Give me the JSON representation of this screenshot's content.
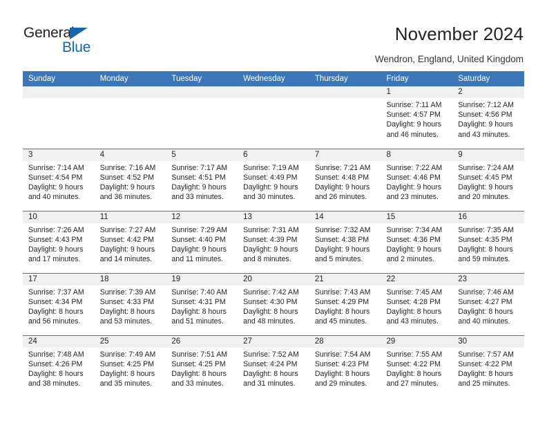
{
  "brand": {
    "name_top": "General",
    "name_bottom": "Blue",
    "color_dark": "#231f20",
    "color_blue": "#1565b0"
  },
  "header": {
    "title": "November 2024",
    "subtitle": "Wendron, England, United Kingdom"
  },
  "theme": {
    "header_blue": "#3a76b8",
    "daynum_band": "#f0f0f0",
    "text": "#222222"
  },
  "weekday_headers": [
    "Sunday",
    "Monday",
    "Tuesday",
    "Wednesday",
    "Thursday",
    "Friday",
    "Saturday"
  ],
  "labels": {
    "sunrise": "Sunrise:",
    "sunset": "Sunset:",
    "daylight": "Daylight:"
  },
  "weeks": [
    [
      {
        "day": ""
      },
      {
        "day": ""
      },
      {
        "day": ""
      },
      {
        "day": ""
      },
      {
        "day": ""
      },
      {
        "day": "1",
        "sunrise": "Sunrise: 7:11 AM",
        "sunset": "Sunset: 4:57 PM",
        "daylight_1": "Daylight: 9 hours",
        "daylight_2": "and 46 minutes."
      },
      {
        "day": "2",
        "sunrise": "Sunrise: 7:12 AM",
        "sunset": "Sunset: 4:56 PM",
        "daylight_1": "Daylight: 9 hours",
        "daylight_2": "and 43 minutes."
      }
    ],
    [
      {
        "day": "3",
        "sunrise": "Sunrise: 7:14 AM",
        "sunset": "Sunset: 4:54 PM",
        "daylight_1": "Daylight: 9 hours",
        "daylight_2": "and 40 minutes."
      },
      {
        "day": "4",
        "sunrise": "Sunrise: 7:16 AM",
        "sunset": "Sunset: 4:52 PM",
        "daylight_1": "Daylight: 9 hours",
        "daylight_2": "and 36 minutes."
      },
      {
        "day": "5",
        "sunrise": "Sunrise: 7:17 AM",
        "sunset": "Sunset: 4:51 PM",
        "daylight_1": "Daylight: 9 hours",
        "daylight_2": "and 33 minutes."
      },
      {
        "day": "6",
        "sunrise": "Sunrise: 7:19 AM",
        "sunset": "Sunset: 4:49 PM",
        "daylight_1": "Daylight: 9 hours",
        "daylight_2": "and 30 minutes."
      },
      {
        "day": "7",
        "sunrise": "Sunrise: 7:21 AM",
        "sunset": "Sunset: 4:48 PM",
        "daylight_1": "Daylight: 9 hours",
        "daylight_2": "and 26 minutes."
      },
      {
        "day": "8",
        "sunrise": "Sunrise: 7:22 AM",
        "sunset": "Sunset: 4:46 PM",
        "daylight_1": "Daylight: 9 hours",
        "daylight_2": "and 23 minutes."
      },
      {
        "day": "9",
        "sunrise": "Sunrise: 7:24 AM",
        "sunset": "Sunset: 4:45 PM",
        "daylight_1": "Daylight: 9 hours",
        "daylight_2": "and 20 minutes."
      }
    ],
    [
      {
        "day": "10",
        "sunrise": "Sunrise: 7:26 AM",
        "sunset": "Sunset: 4:43 PM",
        "daylight_1": "Daylight: 9 hours",
        "daylight_2": "and 17 minutes."
      },
      {
        "day": "11",
        "sunrise": "Sunrise: 7:27 AM",
        "sunset": "Sunset: 4:42 PM",
        "daylight_1": "Daylight: 9 hours",
        "daylight_2": "and 14 minutes."
      },
      {
        "day": "12",
        "sunrise": "Sunrise: 7:29 AM",
        "sunset": "Sunset: 4:40 PM",
        "daylight_1": "Daylight: 9 hours",
        "daylight_2": "and 11 minutes."
      },
      {
        "day": "13",
        "sunrise": "Sunrise: 7:31 AM",
        "sunset": "Sunset: 4:39 PM",
        "daylight_1": "Daylight: 9 hours",
        "daylight_2": "and 8 minutes."
      },
      {
        "day": "14",
        "sunrise": "Sunrise: 7:32 AM",
        "sunset": "Sunset: 4:38 PM",
        "daylight_1": "Daylight: 9 hours",
        "daylight_2": "and 5 minutes."
      },
      {
        "day": "15",
        "sunrise": "Sunrise: 7:34 AM",
        "sunset": "Sunset: 4:36 PM",
        "daylight_1": "Daylight: 9 hours",
        "daylight_2": "and 2 minutes."
      },
      {
        "day": "16",
        "sunrise": "Sunrise: 7:35 AM",
        "sunset": "Sunset: 4:35 PM",
        "daylight_1": "Daylight: 8 hours",
        "daylight_2": "and 59 minutes."
      }
    ],
    [
      {
        "day": "17",
        "sunrise": "Sunrise: 7:37 AM",
        "sunset": "Sunset: 4:34 PM",
        "daylight_1": "Daylight: 8 hours",
        "daylight_2": "and 56 minutes."
      },
      {
        "day": "18",
        "sunrise": "Sunrise: 7:39 AM",
        "sunset": "Sunset: 4:33 PM",
        "daylight_1": "Daylight: 8 hours",
        "daylight_2": "and 53 minutes."
      },
      {
        "day": "19",
        "sunrise": "Sunrise: 7:40 AM",
        "sunset": "Sunset: 4:31 PM",
        "daylight_1": "Daylight: 8 hours",
        "daylight_2": "and 51 minutes."
      },
      {
        "day": "20",
        "sunrise": "Sunrise: 7:42 AM",
        "sunset": "Sunset: 4:30 PM",
        "daylight_1": "Daylight: 8 hours",
        "daylight_2": "and 48 minutes."
      },
      {
        "day": "21",
        "sunrise": "Sunrise: 7:43 AM",
        "sunset": "Sunset: 4:29 PM",
        "daylight_1": "Daylight: 8 hours",
        "daylight_2": "and 45 minutes."
      },
      {
        "day": "22",
        "sunrise": "Sunrise: 7:45 AM",
        "sunset": "Sunset: 4:28 PM",
        "daylight_1": "Daylight: 8 hours",
        "daylight_2": "and 43 minutes."
      },
      {
        "day": "23",
        "sunrise": "Sunrise: 7:46 AM",
        "sunset": "Sunset: 4:27 PM",
        "daylight_1": "Daylight: 8 hours",
        "daylight_2": "and 40 minutes."
      }
    ],
    [
      {
        "day": "24",
        "sunrise": "Sunrise: 7:48 AM",
        "sunset": "Sunset: 4:26 PM",
        "daylight_1": "Daylight: 8 hours",
        "daylight_2": "and 38 minutes."
      },
      {
        "day": "25",
        "sunrise": "Sunrise: 7:49 AM",
        "sunset": "Sunset: 4:25 PM",
        "daylight_1": "Daylight: 8 hours",
        "daylight_2": "and 35 minutes."
      },
      {
        "day": "26",
        "sunrise": "Sunrise: 7:51 AM",
        "sunset": "Sunset: 4:25 PM",
        "daylight_1": "Daylight: 8 hours",
        "daylight_2": "and 33 minutes."
      },
      {
        "day": "27",
        "sunrise": "Sunrise: 7:52 AM",
        "sunset": "Sunset: 4:24 PM",
        "daylight_1": "Daylight: 8 hours",
        "daylight_2": "and 31 minutes."
      },
      {
        "day": "28",
        "sunrise": "Sunrise: 7:54 AM",
        "sunset": "Sunset: 4:23 PM",
        "daylight_1": "Daylight: 8 hours",
        "daylight_2": "and 29 minutes."
      },
      {
        "day": "29",
        "sunrise": "Sunrise: 7:55 AM",
        "sunset": "Sunset: 4:22 PM",
        "daylight_1": "Daylight: 8 hours",
        "daylight_2": "and 27 minutes."
      },
      {
        "day": "30",
        "sunrise": "Sunrise: 7:57 AM",
        "sunset": "Sunset: 4:22 PM",
        "daylight_1": "Daylight: 8 hours",
        "daylight_2": "and 25 minutes."
      }
    ]
  ]
}
